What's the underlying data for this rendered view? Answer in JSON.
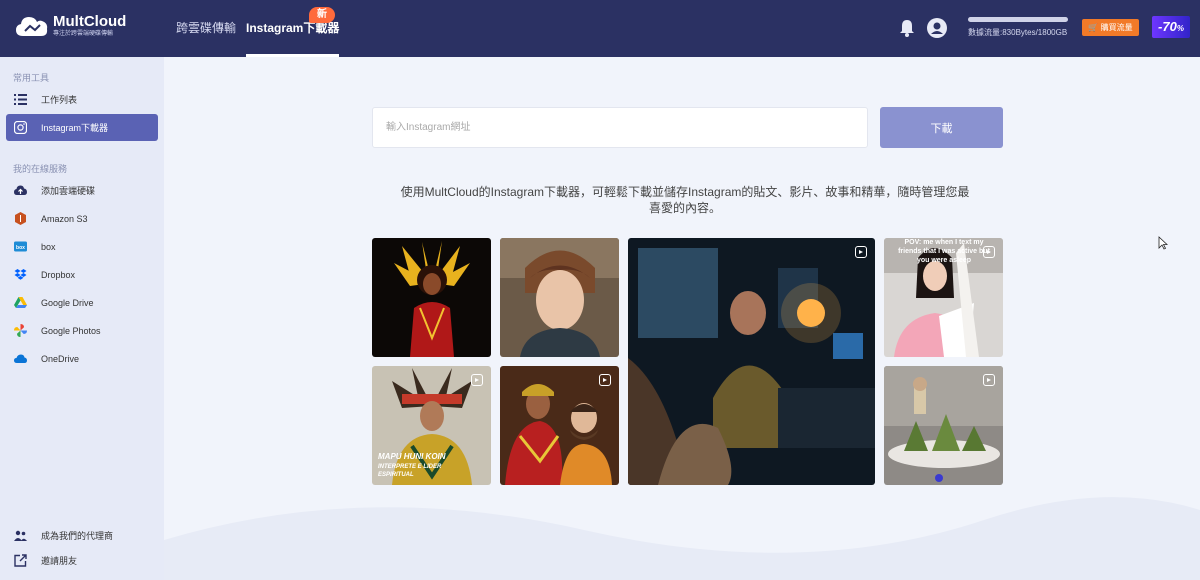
{
  "header": {
    "logo_title": "MultCloud",
    "logo_subtitle": "專注於跨雲端硬碟傳輸",
    "tabs": [
      {
        "label": "跨雲碟傳輸",
        "active": false
      },
      {
        "label": "Instagram下載器",
        "active": true
      }
    ],
    "new_badge": "新",
    "traffic_text": "數據流量:830Bytes/1800GB",
    "buy_label": "購買流量",
    "discount": "-70",
    "discount_unit": "%"
  },
  "sidebar": {
    "common_label": "常用工具",
    "common_items": [
      {
        "label": "工作列表",
        "icon": "list-icon"
      },
      {
        "label": "Instagram下載器",
        "icon": "instagram-icon",
        "active": true
      }
    ],
    "services_label": "我的在線服務",
    "service_items": [
      {
        "label": "添加雲端硬碟",
        "icon": "cloud-upload-icon"
      },
      {
        "label": "Amazon S3",
        "icon": "amazon-s3-icon"
      },
      {
        "label": "box",
        "icon": "box-icon"
      },
      {
        "label": "Dropbox",
        "icon": "dropbox-icon"
      },
      {
        "label": "Google Drive",
        "icon": "google-drive-icon"
      },
      {
        "label": "Google Photos",
        "icon": "google-photos-icon"
      },
      {
        "label": "OneDrive",
        "icon": "onedrive-icon"
      }
    ],
    "bottom_items": [
      {
        "label": "成為我們的代理商",
        "icon": "agent-icon"
      },
      {
        "label": "邀請朋友",
        "icon": "invite-icon"
      }
    ]
  },
  "main": {
    "input_placeholder": "輸入Instagram網址",
    "download_label": "下載",
    "description": "使用MultCloud的Instagram下載器，可輕鬆下載並儲存Instagram的貼文、影片、故事和精華，隨時管理您最喜愛的內容。",
    "captions": {
      "tile5": "MAPU HUNI KOIN",
      "tile5_sub": "INTERPRETE E LIDER ESPIRITUAL",
      "tile4": "POV: me when I text my friends that I was active but you were asleep"
    }
  },
  "colors": {
    "header_bg": "#2b3163",
    "accent": "#5a62b4",
    "button": "#8a92d0",
    "badge": "#ff6a3c",
    "buy": "#f27a28"
  }
}
